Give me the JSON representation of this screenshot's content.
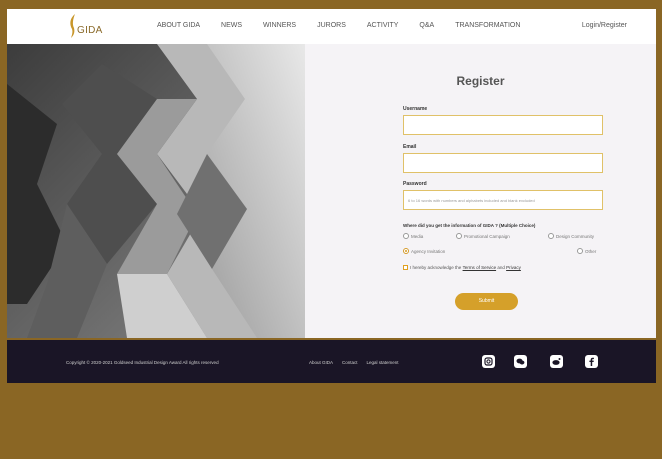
{
  "header": {
    "logo_text": "GIDA",
    "nav": [
      "ABOUT GIDA",
      "NEWS",
      "WINNERS",
      "JURORS",
      "ACTIVITY",
      "Q&A",
      "TRANSFORMATION"
    ],
    "login": "Login/Register"
  },
  "register": {
    "title": "Register",
    "username_label": "Username",
    "email_label": "Email",
    "password_label": "Password",
    "password_placeholder": "6 to 16 words with numbers and alphabets included and blank excluded",
    "question": "Where did you get the information of GIDA ? (Multiple Choice)",
    "options": [
      {
        "label": "Media",
        "selected": false
      },
      {
        "label": "Promotional Campaign",
        "selected": false
      },
      {
        "label": "Design Community",
        "selected": false
      },
      {
        "label": "Agency Invitation",
        "selected": true
      },
      {
        "label": "Other",
        "selected": false
      }
    ],
    "agree_prefix": "I hereby acknowledge the",
    "terms_link": "Terms of Service",
    "agree_and": "and",
    "privacy_link": "Privacy",
    "submit": "Submit"
  },
  "footer": {
    "copyright": "Copyright © 2020-2021 Goldseed Industrial Design Award All rights reserved",
    "links": [
      "About GIDA",
      "Contact",
      "Legal statement"
    ],
    "social_icons": [
      "instagram-icon",
      "wechat-icon",
      "weibo-icon",
      "facebook-icon"
    ]
  },
  "colors": {
    "accent": "#d5a02a",
    "field_border": "#e0c168",
    "footer_bg": "#1a1526",
    "page_bg": "#8a6624"
  }
}
